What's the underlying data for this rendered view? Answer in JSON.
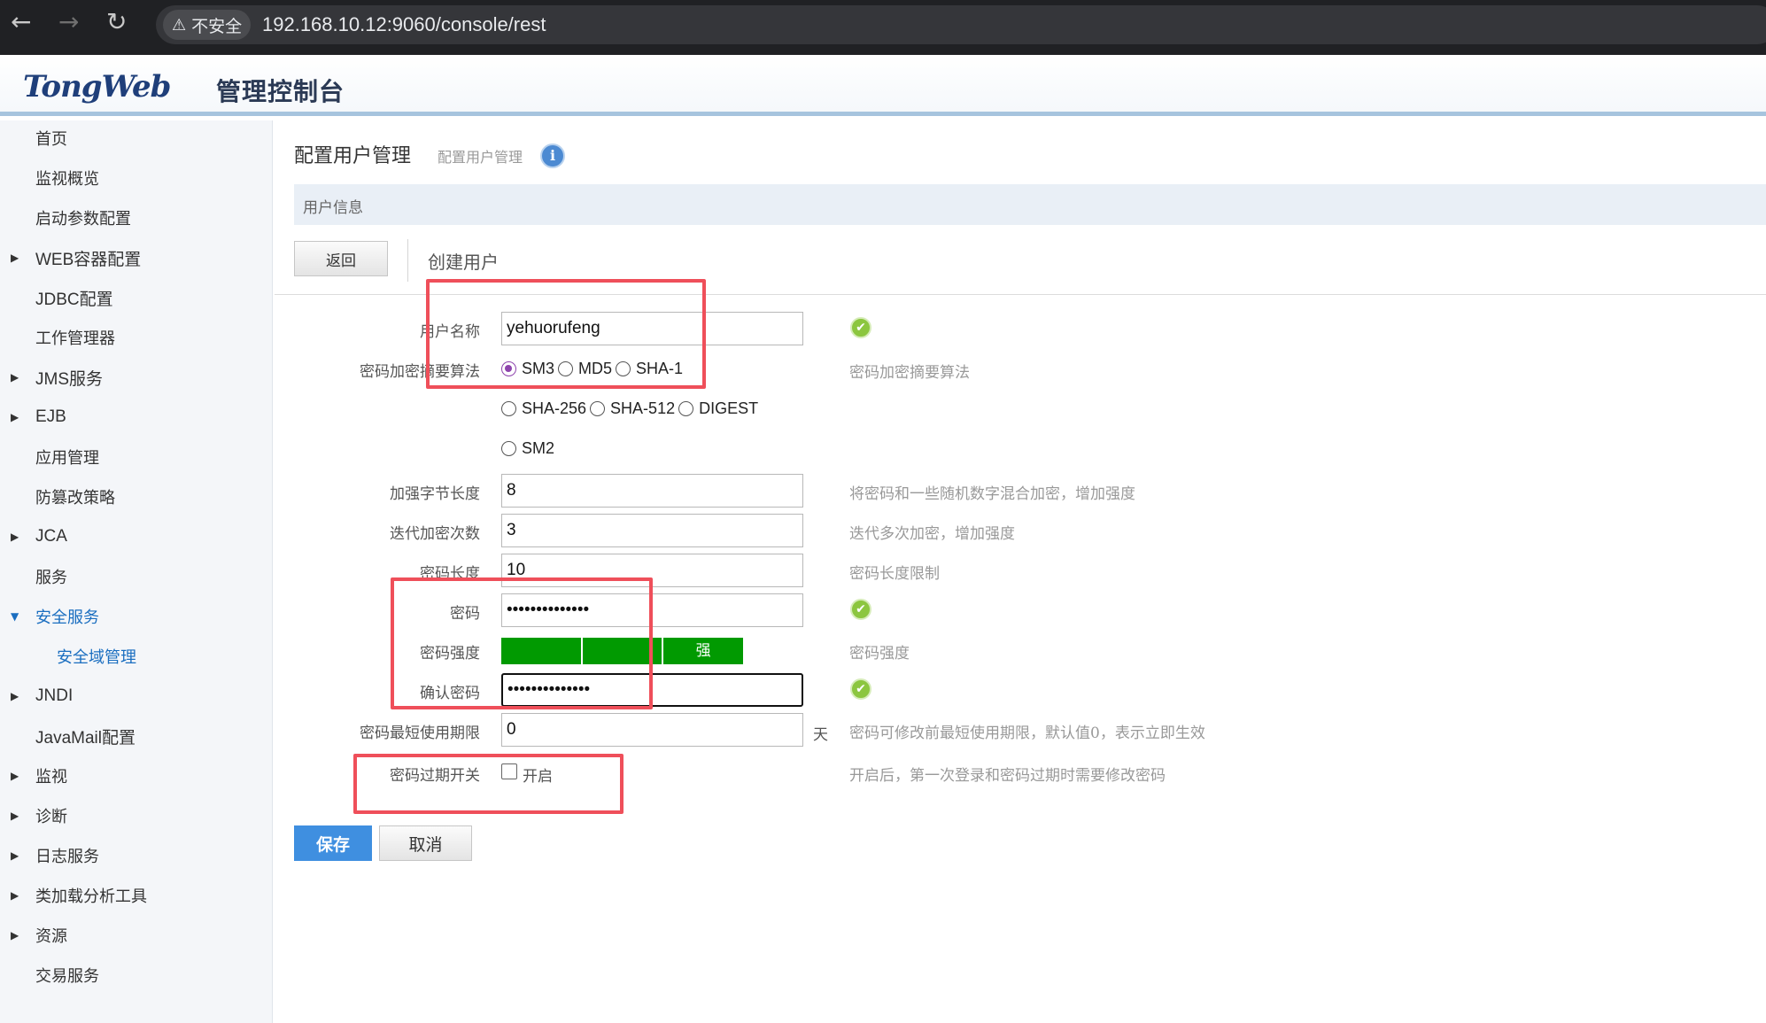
{
  "browser": {
    "back_icon": "←",
    "forward_icon": "→",
    "reload_icon": "↻",
    "security_warning_icon": "⚠",
    "security_label": "不安全",
    "url": "192.168.10.12:9060/console/rest"
  },
  "header": {
    "logo_text_a": "Tong",
    "logo_text_b": "Web",
    "console_title": "管理控制台"
  },
  "sidebar": {
    "items": [
      {
        "label": "首页"
      },
      {
        "label": "监视概览"
      },
      {
        "label": "启动参数配置"
      },
      {
        "label": "WEB容器配置"
      },
      {
        "label": "JDBC配置"
      },
      {
        "label": "工作管理器"
      },
      {
        "label": "JMS服务"
      },
      {
        "label": "EJB"
      },
      {
        "label": "应用管理"
      },
      {
        "label": "防篡改策略"
      },
      {
        "label": "JCA"
      },
      {
        "label": "服务"
      },
      {
        "label": "安全服务"
      },
      {
        "label": "安全域管理"
      },
      {
        "label": "JNDI"
      },
      {
        "label": "JavaMail配置"
      },
      {
        "label": "监视"
      },
      {
        "label": "诊断"
      },
      {
        "label": "日志服务"
      },
      {
        "label": "类加载分析工具"
      },
      {
        "label": "资源"
      },
      {
        "label": "交易服务"
      }
    ]
  },
  "main": {
    "title": "配置用户管理",
    "breadcrumb": "配置用户管理",
    "info_icon": "i",
    "section_title": "用户信息",
    "back_label": "返回",
    "form_title": "创建用户",
    "form": {
      "username": {
        "label": "用户名称",
        "value": "yehuorufeng"
      },
      "algorithm": {
        "label": "密码加密摘要算法",
        "options": [
          "SM3",
          "MD5",
          "SHA-1",
          "SHA-256",
          "SHA-512",
          "DIGEST",
          "SM2"
        ],
        "selected": "SM3",
        "help": "密码加密摘要算法"
      },
      "salt_length": {
        "label": "加强字节长度",
        "value": "8",
        "help": "将密码和一些随机数字混合加密，增加强度"
      },
      "iterations": {
        "label": "迭代加密次数",
        "value": "3",
        "help": "迭代多次加密，增加强度"
      },
      "password_length": {
        "label": "密码长度",
        "value": "10",
        "help": "密码长度限制"
      },
      "password": {
        "label": "密码",
        "value": "••••••••••••••"
      },
      "strength": {
        "label": "密码强度",
        "level_text": "强",
        "help": "密码强度",
        "level": 1.0
      },
      "confirm_password": {
        "label": "确认密码",
        "value": "••••••••••••••"
      },
      "min_age": {
        "label": "密码最短使用期限",
        "value": "0",
        "unit": "天",
        "help": "密码可修改前最短使用期限，默认值0，表示立即生效"
      },
      "expiry_switch": {
        "label": "密码过期开关",
        "option": "开启",
        "checked": false,
        "help": "开启后，第一次登录和密码过期时需要修改密码"
      }
    },
    "valid_icon": "✔",
    "save_label": "保存",
    "cancel_label": "取消"
  },
  "colors": {
    "annotation_red": "#ef4f5a",
    "strength_green": "#019a01",
    "save_blue": "#3f8fe0"
  }
}
